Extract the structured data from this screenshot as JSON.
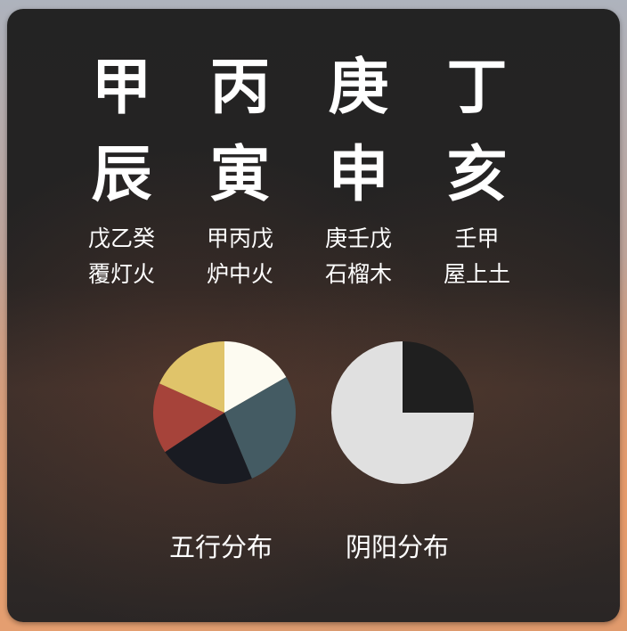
{
  "pillars": [
    {
      "stem": "甲",
      "branch": "辰",
      "hidden_stems": "戊乙癸",
      "nayin": "覆灯火"
    },
    {
      "stem": "丙",
      "branch": "寅",
      "hidden_stems": "甲丙戊",
      "nayin": "炉中火"
    },
    {
      "stem": "庚",
      "branch": "申",
      "hidden_stems": "庚壬戊",
      "nayin": "石榴木"
    },
    {
      "stem": "丁",
      "branch": "亥",
      "hidden_stems": "壬甲",
      "nayin": "屋上土"
    }
  ],
  "labels": {
    "wuxing": "五行分布",
    "yinyang": "阴阳分布"
  },
  "chart_data": [
    {
      "type": "pie",
      "title": "五行分布",
      "values": [
        0.167,
        0.27,
        0.22,
        0.16,
        0.183
      ],
      "colors": [
        "#fdfbf1",
        "#445b63",
        "#191b22",
        "#a6433a",
        "#e0c46a"
      ]
    },
    {
      "type": "pie",
      "title": "阴阳分布",
      "values": [
        0.25,
        0.75
      ],
      "colors": [
        "#1f1f1f",
        "#e0e0e0"
      ]
    }
  ]
}
